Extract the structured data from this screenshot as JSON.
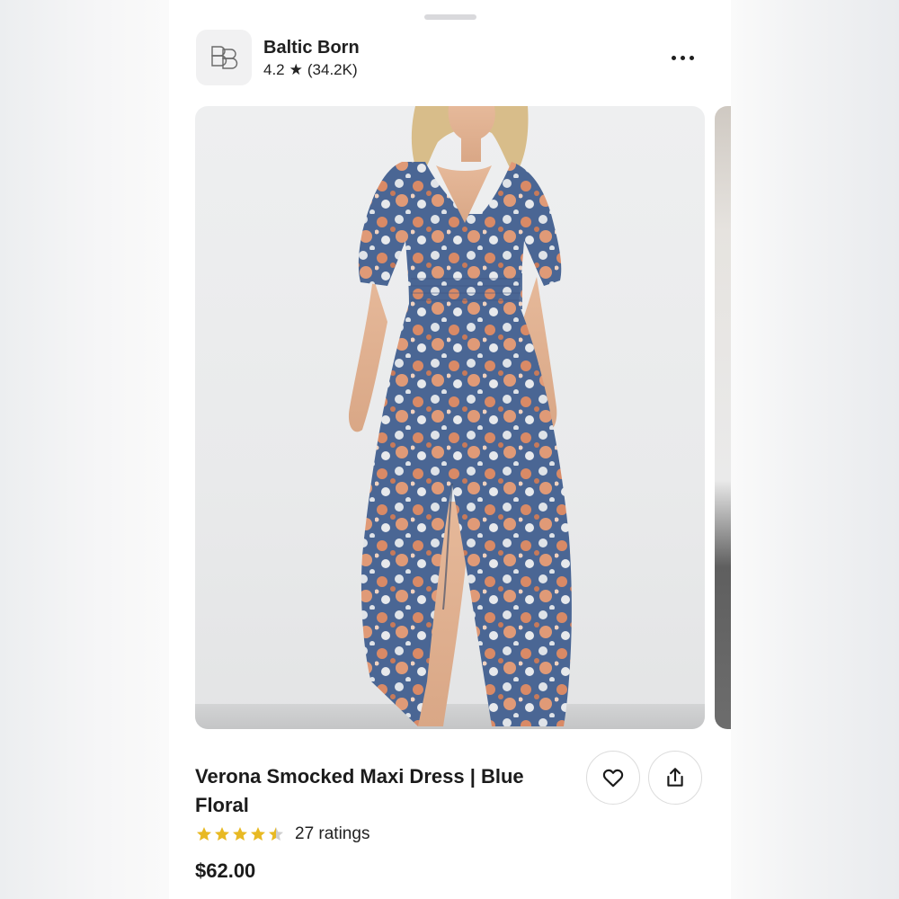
{
  "seller": {
    "name": "Baltic Born",
    "rating": "4.2",
    "star": "★",
    "review_count": "(34.2K)",
    "logo_icon": "baltic-born-logo"
  },
  "header": {
    "more_icon": "more-horizontal-icon"
  },
  "product": {
    "title": "Verona Smocked Maxi Dress | Blue Floral",
    "stars_value": 4.5,
    "stars_max": 5,
    "star_color": "#e8b923",
    "ratings_label": "27 ratings",
    "price": "$62.00",
    "favorite_icon": "heart-icon",
    "share_icon": "share-icon"
  }
}
